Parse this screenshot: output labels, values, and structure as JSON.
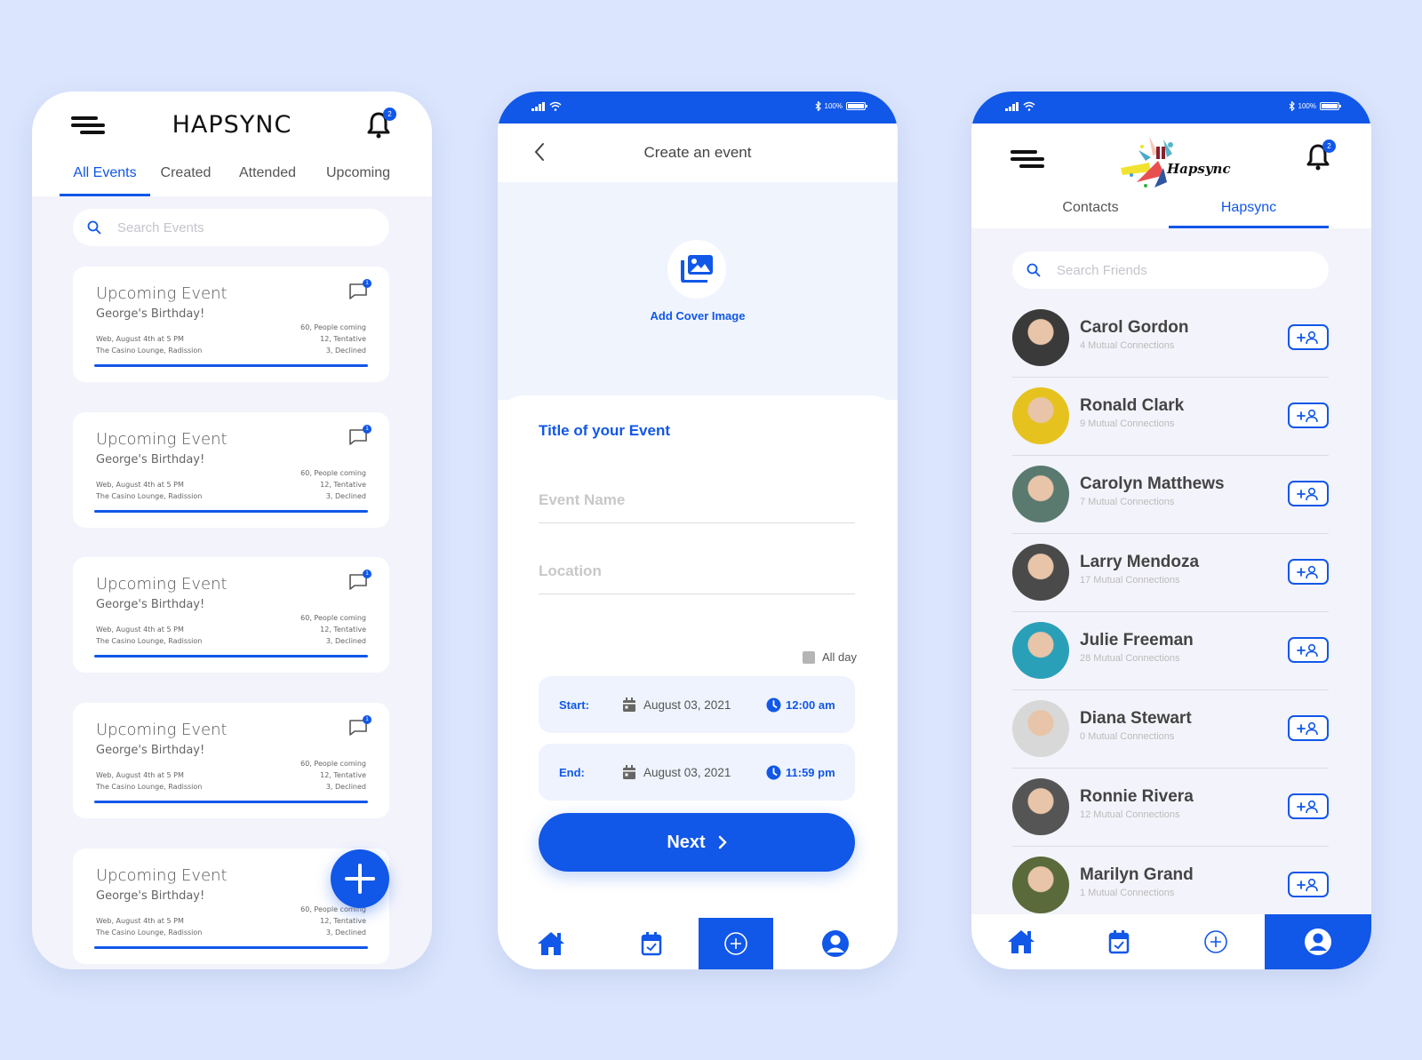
{
  "colors": {
    "accent": "#1157e8",
    "background": "#dbe5fd",
    "card": "#ffffff",
    "panel": "#f3f3fb"
  },
  "status_bar": {
    "battery": "100%",
    "battery_level": 1.0
  },
  "events_screen": {
    "brand": "HAPSYNC",
    "notification_count": "2",
    "tabs": [
      {
        "label": "All Events",
        "active": true
      },
      {
        "label": "Created",
        "active": false
      },
      {
        "label": "Attended",
        "active": false
      },
      {
        "label": "Upcoming",
        "active": false
      }
    ],
    "search_placeholder": "Search Events",
    "events": [
      {
        "title": "Upcoming Event",
        "name": "George's Birthday!",
        "date": "Web, August 4th at 5 PM",
        "venue": "The Casino Lounge, Radission",
        "coming": "60, People coming",
        "tentative": "12, Tentative",
        "declined": "3, Declined",
        "chat_count": "1",
        "progress": 1.0
      },
      {
        "title": "Upcoming Event",
        "name": "George's Birthday!",
        "date": "Web, August 4th at 5 PM",
        "venue": "The Casino Lounge, Radission",
        "coming": "60, People coming",
        "tentative": "12, Tentative",
        "declined": "3, Declined",
        "chat_count": "1",
        "progress": 1.0
      },
      {
        "title": "Upcoming Event",
        "name": "George's Birthday!",
        "date": "Web, August 4th at 5 PM",
        "venue": "The Casino Lounge, Radission",
        "coming": "60, People coming",
        "tentative": "12, Tentative",
        "declined": "3, Declined",
        "chat_count": "1",
        "progress": 1.0
      },
      {
        "title": "Upcoming Event",
        "name": "George's Birthday!",
        "date": "Web, August 4th at 5 PM",
        "venue": "The Casino Lounge, Radission",
        "coming": "60, People coming",
        "tentative": "12, Tentative",
        "declined": "3, Declined",
        "chat_count": "1",
        "progress": 1.0
      },
      {
        "title": "Upcoming Event",
        "name": "George's Birthday!",
        "date": "Web, August 4th at 5 PM",
        "venue": "The Casino Lounge, Radission",
        "coming": "60, People coming",
        "tentative": "12, Tentative",
        "declined": "3, Declined",
        "chat_count": "1",
        "progress": 1.0
      }
    ],
    "fab_icon": "plus-icon"
  },
  "create_screen": {
    "title": "Create an event",
    "add_cover_label": "Add Cover Image",
    "form_heading": "Title of your Event",
    "event_name_placeholder": "Event Name",
    "location_placeholder": "Location",
    "all_day_label": "All day",
    "start": {
      "label": "Start:",
      "date": "August 03, 2021",
      "time": "12:00 am"
    },
    "end": {
      "label": "End:",
      "date": "August 03, 2021",
      "time": "11:59 pm"
    },
    "next_label": "Next",
    "bottom_nav": [
      {
        "icon": "home-icon",
        "active": false
      },
      {
        "icon": "calendar-check-icon",
        "active": false
      },
      {
        "icon": "add-circle-icon",
        "active": true
      },
      {
        "icon": "profile-icon",
        "active": false
      }
    ]
  },
  "friends_screen": {
    "logo_text": "Hapsync",
    "notification_count": "2",
    "tabs": [
      {
        "label": "Contacts",
        "active": false
      },
      {
        "label": "Hapsync",
        "active": true
      }
    ],
    "search_placeholder": "Search Friends",
    "contacts": [
      {
        "name": "Carol Gordon",
        "mutual": "4 Mutual Connections"
      },
      {
        "name": "Ronald Clark",
        "mutual": "9 Mutual Connections"
      },
      {
        "name": "Carolyn Matthews",
        "mutual": "7 Mutual Connections"
      },
      {
        "name": "Larry Mendoza",
        "mutual": "17 Mutual Connections"
      },
      {
        "name": "Julie Freeman",
        "mutual": "28 Mutual Connections"
      },
      {
        "name": "Diana Stewart",
        "mutual": "0 Mutual Connections"
      },
      {
        "name": "Ronnie Rivera",
        "mutual": "12 Mutual Connections"
      },
      {
        "name": "Marilyn Grand",
        "mutual": "1 Mutual Connections"
      }
    ],
    "bottom_nav": [
      {
        "icon": "home-icon",
        "active": false
      },
      {
        "icon": "calendar-check-icon",
        "active": false
      },
      {
        "icon": "add-circle-icon",
        "active": false
      },
      {
        "icon": "profile-icon",
        "active": true
      }
    ]
  }
}
